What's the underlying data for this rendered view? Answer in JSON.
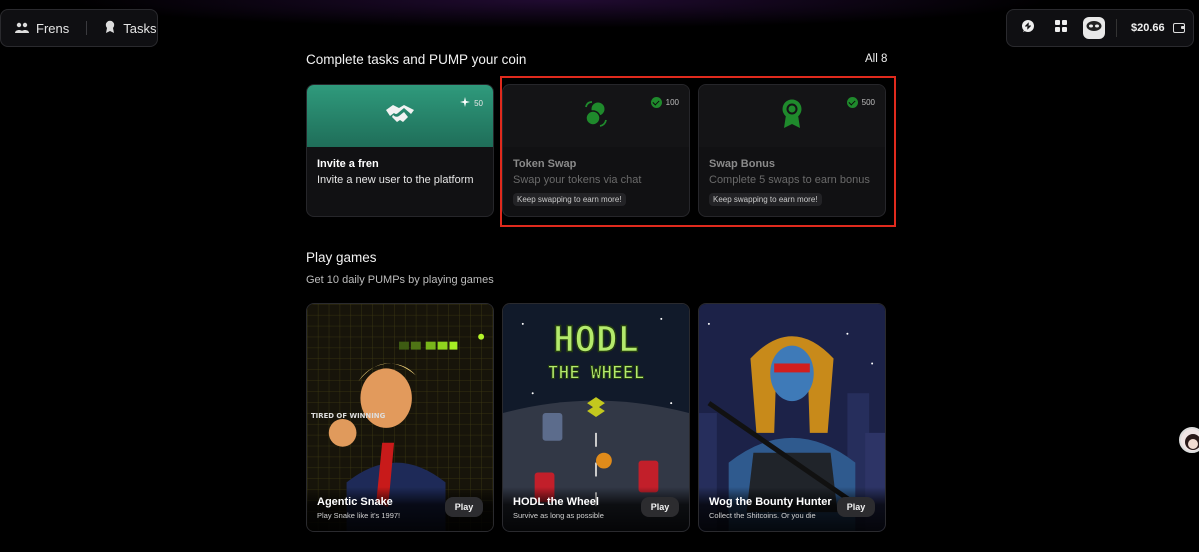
{
  "nav": {
    "frens_label": "Frens",
    "tasks_label": "Tasks"
  },
  "toolbar": {
    "chat_icon": "chat-bubble-icon",
    "apps_icon": "grid-icon",
    "mask_icon": "mask-icon",
    "balance": "$20.66",
    "wallet_icon": "wallet-icon"
  },
  "tasks_section": {
    "title": "Complete tasks and PUMP your coin",
    "all_label": "All 8",
    "cards": [
      {
        "title": "Invite a fren",
        "description": "Invite a new user to the platform",
        "reward": "50",
        "icon": "handshake-icon",
        "completed": false
      },
      {
        "title": "Token Swap",
        "description": "Swap your tokens via chat",
        "reward": "100",
        "icon": "coins-swap-icon",
        "badge": "Keep swapping to earn more!",
        "completed": true
      },
      {
        "title": "Swap Bonus",
        "description": "Complete 5 swaps to earn bonus",
        "reward": "500",
        "icon": "award-ribbon-icon",
        "badge": "Keep swapping to earn more!",
        "completed": true
      }
    ]
  },
  "games_section": {
    "title": "Play games",
    "subtitle": "Get 10 daily PUMPs by playing games",
    "cards": [
      {
        "title": "Agentic Snake",
        "subtitle": "Play Snake like it's 1997!",
        "play_label": "Play",
        "art_text": "TIRED OF WINNING"
      },
      {
        "title": "HODL the Wheel",
        "subtitle": "Survive as long as possible",
        "play_label": "Play",
        "art_text_1": "HODL",
        "art_text_2": "THE WHEEL"
      },
      {
        "title": "Wog the Bounty Hunter",
        "subtitle": "Collect the Shitcoins. Or you die",
        "play_label": "Play"
      }
    ]
  },
  "colors": {
    "accent_green": "#1f8a2c",
    "invite_teal": "#2f9a7c",
    "highlight_red": "#e02a1d"
  }
}
